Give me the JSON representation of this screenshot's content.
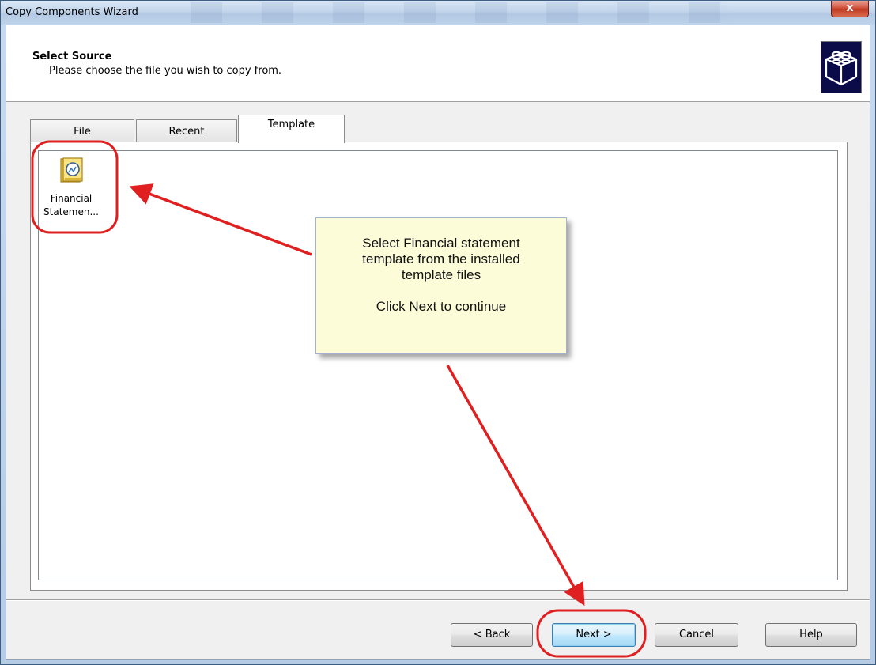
{
  "window": {
    "title": "Copy Components Wizard",
    "close_glyph": "x"
  },
  "header": {
    "title": "Select Source",
    "subtitle": "Please choose the file you wish to copy from.",
    "logo_icon": "lego-brick-icon"
  },
  "tabs": [
    {
      "label": "File",
      "active": false
    },
    {
      "label": "Recent",
      "active": false
    },
    {
      "label": "Template",
      "active": true
    }
  ],
  "template_items": [
    {
      "label_line1": "Financial",
      "label_line2": "Statemen...",
      "icon": "template-document-icon"
    }
  ],
  "callout": {
    "line1": "Select Financial statement",
    "line2": "template from the installed",
    "line3": "template files",
    "line4": "Click Next to continue"
  },
  "buttons": {
    "back": "< Back",
    "next": "Next >",
    "cancel": "Cancel",
    "help": "Help"
  },
  "colors": {
    "annotation_red": "#e02020",
    "callout_bg": "#fcfcd8",
    "title_bar": "#c4d6ec"
  }
}
